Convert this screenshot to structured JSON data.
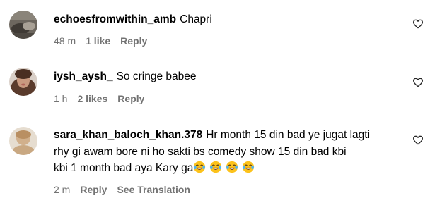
{
  "comments": [
    {
      "username": "echoesfromwithin_amb",
      "text_lines": [
        "Chapri"
      ],
      "time": "48 m",
      "likes": "1 like",
      "reply": "Reply",
      "translation": ""
    },
    {
      "username": "iysh_aysh_",
      "text_lines": [
        "So cringe babee"
      ],
      "time": "1 h",
      "likes": "2 likes",
      "reply": "Reply",
      "translation": ""
    },
    {
      "username": "sara_khan_baloch_khan.378",
      "text_lines": [
        "Hr month 15 din bad ye jugat lagti",
        "rhy gi awam bore ni ho sakti bs comedy show 15 din bad kbi",
        "kbi 1 month bad aya Kary ga"
      ],
      "emojis": [
        "face-with-tears-of-joy",
        "face-with-tears-of-joy",
        "face-with-tears-of-joy",
        "face-with-tears-of-joy"
      ],
      "time": "2 m",
      "likes": "",
      "reply": "Reply",
      "translation": "See Translation"
    }
  ],
  "icons": {
    "like": "heart-outline-icon"
  },
  "colors": {
    "text": "#000000",
    "meta": "#737373",
    "background": "#ffffff"
  }
}
